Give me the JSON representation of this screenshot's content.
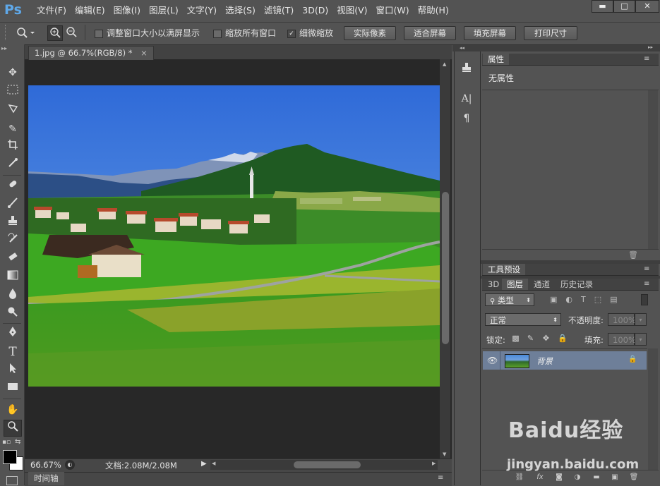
{
  "app": {
    "logo": "Ps"
  },
  "menu": [
    "文件(F)",
    "编辑(E)",
    "图像(I)",
    "图层(L)",
    "文字(Y)",
    "选择(S)",
    "滤镜(T)",
    "3D(D)",
    "视图(V)",
    "窗口(W)",
    "帮助(H)"
  ],
  "window_controls": {
    "minimize": "▬",
    "maximize": "□",
    "close": "✕"
  },
  "options": {
    "chk_resize_label": "调整窗口大小以满屏显示",
    "chk_all_windows_label": "缩放所有窗口",
    "chk_scrubby_label": "细微缩放",
    "btn_actual": "实际像素",
    "btn_fit": "适合屏幕",
    "btn_fill": "填充屏幕",
    "btn_print": "打印尺寸"
  },
  "document": {
    "tab_title": "1.jpg @ 66.7%(RGB/8) *",
    "tab_close": "×",
    "zoom": "66.67%",
    "doc_info": "文档:2.08M/2.08M"
  },
  "timeline": {
    "label": "时间轴"
  },
  "properties": {
    "tab": "属性",
    "content": "无属性"
  },
  "tool_presets": {
    "tab": "工具预设"
  },
  "layers_panel": {
    "tabs": [
      "3D",
      "图层",
      "通道",
      "历史记录"
    ],
    "filter_type": "类型",
    "blend_mode": "正常",
    "opacity_label": "不透明度:",
    "opacity_value": "100%",
    "lock_label": "锁定:",
    "fill_label": "填充:",
    "fill_value": "100%",
    "layer_name": "背景"
  },
  "watermark": {
    "line1": "Baidu经验",
    "line2": "jingyan.baidu.com"
  },
  "colors": {
    "ui_gray": "#535353",
    "canvas_bg": "#282828",
    "selected_layer": "#6e7f99",
    "logo_blue": "#5fa8e8"
  }
}
